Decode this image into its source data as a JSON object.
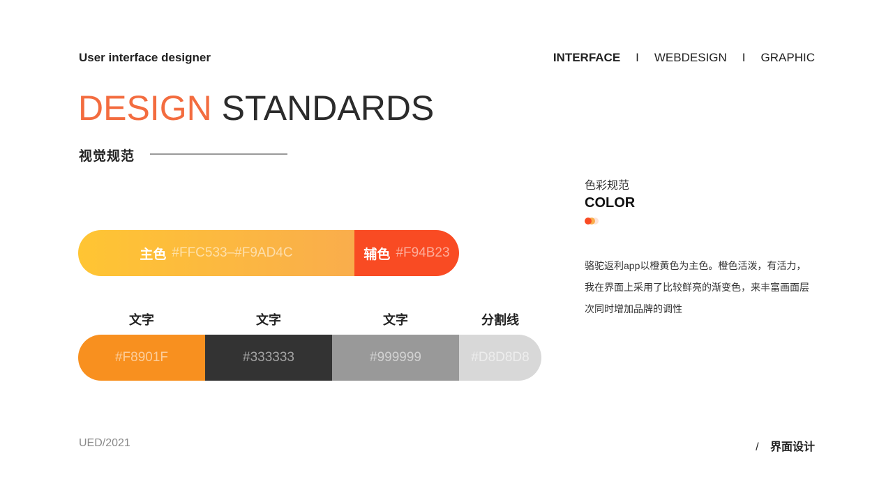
{
  "header": {
    "subtitle": "User interface designer",
    "nav": [
      "INTERFACE",
      "WEBDESIGN",
      "GRAPHIC"
    ],
    "nav_separator": "I",
    "active_nav": "INTERFACE"
  },
  "title": {
    "part1": "DESIGN",
    "part2": "STANDARDS"
  },
  "section": {
    "label": "视觉规范"
  },
  "brand_colors": {
    "main": {
      "label": "主色",
      "hex_text": "#FFC533–#F9AD4C",
      "from": "#FFC533",
      "to": "#F9AD4C"
    },
    "secondary": {
      "label": "辅色",
      "hex_text": "#F94B23",
      "color": "#F94B23"
    }
  },
  "text_colors": [
    {
      "label": "文字",
      "hex_text": "#F8901F",
      "color": "#F8901F"
    },
    {
      "label": "文字",
      "hex_text": "#333333",
      "color": "#333333"
    },
    {
      "label": "文字",
      "hex_text": "#999999",
      "color": "#999999"
    },
    {
      "label": "分割线",
      "hex_text": "#D8D8D8",
      "color": "#D8D8D8"
    }
  ],
  "color_spec": {
    "cn": "色彩规范",
    "en": "COLOR",
    "description": "骆驼返利app以橙黄色为主色。橙色活泼，有活力，我在界面上采用了比较鲜亮的渐变色，来丰富画面层次同时增加品牌的调性",
    "dot_colors": [
      "#F94B23",
      "#F9AD4C",
      "#FDE3D8"
    ]
  },
  "footer": {
    "left": "UED/2021",
    "slash": "/",
    "right": "界面设计"
  }
}
